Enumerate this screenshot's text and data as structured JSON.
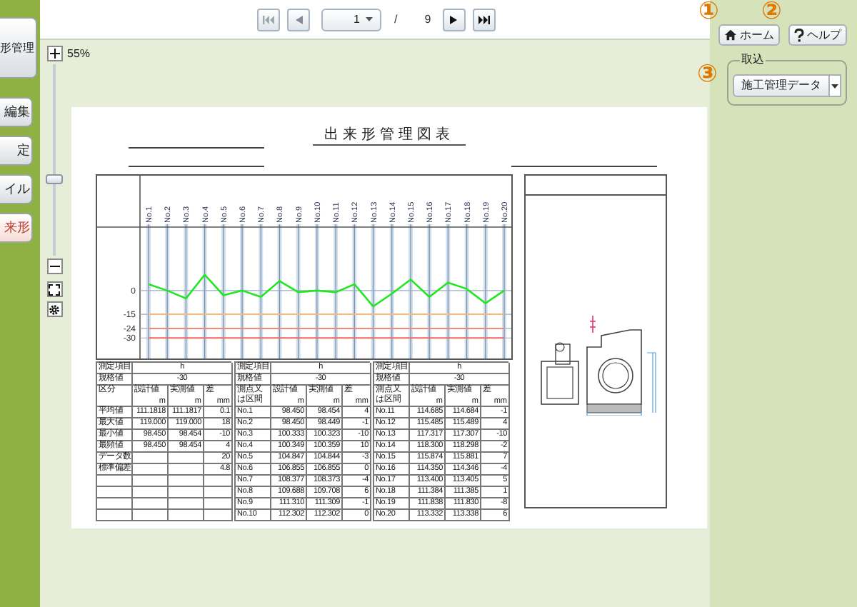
{
  "sidebar": {
    "items": [
      {
        "label": "形管理",
        "selected": false
      },
      {
        "label": "編集",
        "selected": false
      },
      {
        "label": "定",
        "selected": false
      },
      {
        "label": "イル",
        "selected": false
      },
      {
        "label": "来形",
        "selected": true
      }
    ]
  },
  "zoom": {
    "percent": "55%",
    "level": 0.39
  },
  "pager": {
    "page": "1",
    "separator": "/",
    "total": "9"
  },
  "header_buttons": [
    {
      "label": "ホーム",
      "kind": "home"
    },
    {
      "label": "ヘルプ",
      "kind": "help"
    }
  ],
  "import_group": {
    "legend": "取込",
    "value": "施工管理データ"
  },
  "callouts": [
    "①",
    "②",
    "③"
  ],
  "document": {
    "title": "出来形管理図表",
    "chart": {
      "chart_data": {
        "type": "line",
        "categories": [
          "No.1",
          "No.2",
          "No.3",
          "No.4",
          "No.5",
          "No.6",
          "No.7",
          "No.8",
          "No.9",
          "No.10",
          "No.11",
          "No.12",
          "No.13",
          "No.14",
          "No.15",
          "No.16",
          "No.17",
          "No.18",
          "No.19",
          "No.20"
        ],
        "series": [
          {
            "color": "#22e622",
            "values": [
              4,
              0,
              -5,
              10,
              -3,
              0,
              -4,
              6,
              -1,
              0,
              -1,
              4,
              -10,
              -2,
              7,
              -4,
              5,
              1,
              -8,
              0
            ]
          },
          {
            "color": "#f8b878",
            "values": [
              -15,
              -15,
              -15,
              -15,
              -15,
              -15,
              -15,
              -15,
              -15,
              -15,
              -15,
              -15,
              -15,
              -15,
              -15,
              -15,
              -15,
              -15,
              -15,
              -15
            ]
          },
          {
            "color": "#f08a78",
            "values": [
              -24,
              -24,
              -24,
              -24,
              -24,
              -24,
              -24,
              -24,
              -24,
              -24,
              -24,
              -24,
              -24,
              -24,
              -24,
              -24,
              -24,
              -24,
              -24,
              -24
            ]
          },
          {
            "color": "#f06a6a",
            "values": [
              -30,
              -30,
              -30,
              -30,
              -30,
              -30,
              -30,
              -30,
              -30,
              -30,
              -30,
              -30,
              -30,
              -30,
              -30,
              -30,
              -30,
              -30,
              -30,
              -30
            ]
          }
        ],
        "ylim": [
          -43,
          72.7
        ],
        "yticks": [
          0,
          -15,
          -24,
          -30
        ],
        "grid": true
      }
    },
    "summary_table": {
      "item_label": "測定項目",
      "item_value": "h",
      "spec_label": "規格値",
      "spec_value": "-30",
      "columns": [
        "区分",
        "設計値",
        "実測値",
        "差"
      ],
      "units": [
        "m",
        "m",
        "mm"
      ],
      "rows": [
        {
          "label": "平均値",
          "design": "111.1818",
          "measured": "111.1817",
          "diff": "0.1"
        },
        {
          "label": "最大値",
          "design": "119.000",
          "measured": "119.000",
          "diff": "18"
        },
        {
          "label": "最小値",
          "design": "98.450",
          "measured": "98.454",
          "diff": "-10"
        },
        {
          "label": "最頻値",
          "design": "98.450",
          "measured": "98.454",
          "diff": "4"
        },
        {
          "label": "データ数",
          "diff": "20"
        },
        {
          "label": "標準偏差",
          "diff": "4.8"
        }
      ]
    },
    "point_tables": [
      {
        "item_label": "測定項目",
        "item_value": "h",
        "spec_label": "規格値",
        "spec_value": "-30",
        "columns": [
          "測点又は区間",
          "設計値",
          "実測値",
          "差"
        ],
        "units": [
          "m",
          "m",
          "mm"
        ],
        "rows": [
          [
            "No.1",
            "98.450",
            "98.454",
            "4"
          ],
          [
            "No.2",
            "98.450",
            "98.449",
            "-1"
          ],
          [
            "No.3",
            "100.333",
            "100.323",
            "-10"
          ],
          [
            "No.4",
            "100.349",
            "100.359",
            "10"
          ],
          [
            "No.5",
            "104.847",
            "104.844",
            "-3"
          ],
          [
            "No.6",
            "106.855",
            "106.855",
            "0"
          ],
          [
            "No.7",
            "108.377",
            "108.373",
            "-4"
          ],
          [
            "No.8",
            "109.688",
            "109.708",
            "6"
          ],
          [
            "No.9",
            "111.310",
            "111.309",
            "-1"
          ],
          [
            "No.10",
            "112.302",
            "112.302",
            "0"
          ]
        ]
      },
      {
        "item_label": "測定項目",
        "item_value": "h",
        "spec_label": "規格値",
        "spec_value": "-30",
        "columns": [
          "測点又は区間",
          "設計値",
          "実測値",
          "差"
        ],
        "units": [
          "m",
          "m",
          "mm"
        ],
        "rows": [
          [
            "No.11",
            "114.685",
            "114.684",
            "-1"
          ],
          [
            "No.12",
            "115.485",
            "115.489",
            "4"
          ],
          [
            "No.13",
            "117.317",
            "117.307",
            "-10"
          ],
          [
            "No.14",
            "118.300",
            "118.298",
            "-2"
          ],
          [
            "No.15",
            "115.874",
            "115.881",
            "7"
          ],
          [
            "No.16",
            "114.350",
            "114.346",
            "-4"
          ],
          [
            "No.17",
            "113.400",
            "113.405",
            "5"
          ],
          [
            "No.18",
            "111.384",
            "111.385",
            "1"
          ],
          [
            "No.19",
            "111.838",
            "111.830",
            "-8"
          ],
          [
            "No.20",
            "113.332",
            "113.338",
            "6"
          ]
        ]
      }
    ]
  }
}
